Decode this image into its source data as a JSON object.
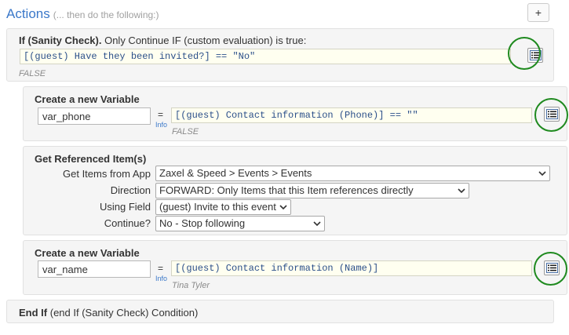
{
  "header": {
    "title": "Actions",
    "subtitle": "(... then do the following:)",
    "add_label": "+"
  },
  "if_block": {
    "title": "If (Sanity Check).",
    "description": "Only Continue IF (custom evaluation) is true:",
    "expression": "[(guest) Have they been invited?] == \"No\"",
    "evaluation": "FALSE"
  },
  "var_phone": {
    "title": "Create a new Variable",
    "name_value": "var_phone",
    "equals": "=",
    "info": "Info",
    "expression": "[(guest) Contact information (Phone)] == \"\"",
    "evaluation": "FALSE"
  },
  "get_items": {
    "title": "Get Referenced Item(s)",
    "rows": [
      {
        "label": "Get Items from App",
        "value": "Zaxel & Speed > Events > Events"
      },
      {
        "label": "Direction",
        "value": "FORWARD: Only Items that this Item references directly"
      },
      {
        "label": "Using Field",
        "value": "(guest) Invite to this event"
      },
      {
        "label": "Continue?",
        "value": "No - Stop following"
      }
    ]
  },
  "var_name": {
    "title": "Create a new Variable",
    "name_value": "var_name",
    "equals": "=",
    "info": "Info",
    "expression": "[(guest) Contact information (Name)]",
    "evaluation": "Tina Tyler"
  },
  "end_if": {
    "title": "End If",
    "description": "(end If (Sanity Check) Condition)"
  },
  "icons": {
    "field_picker": "field-list-icon",
    "add": "plus-icon",
    "dropdown": "chevron-down-icon"
  },
  "colors": {
    "accent": "#3b78c9",
    "highlight_ring": "#1f8a1f",
    "code_bg": "#fffff0"
  }
}
